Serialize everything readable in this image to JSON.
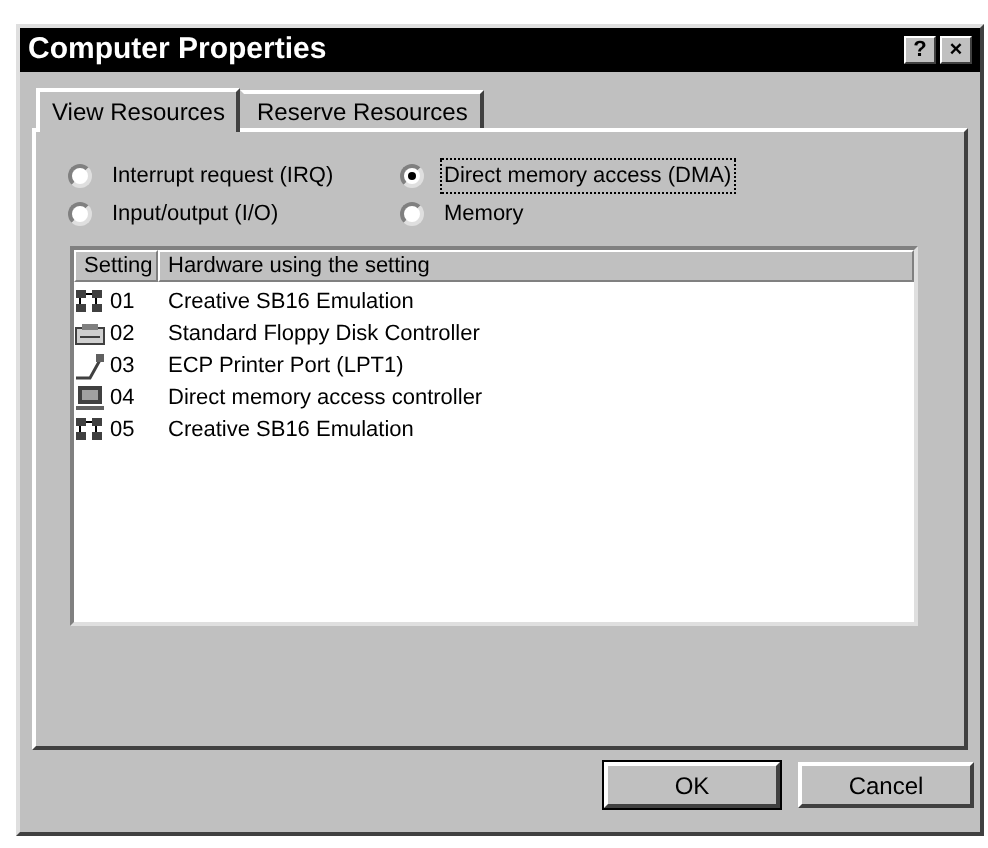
{
  "window": {
    "title": "Computer Properties",
    "buttons": [
      "?",
      "×"
    ]
  },
  "tabs": [
    {
      "label": "View Resources",
      "selected": true
    },
    {
      "label": "Reserve Resources",
      "selected": false
    }
  ],
  "options": [
    {
      "label": "Interrupt request (IRQ)",
      "selected": false
    },
    {
      "label": "Direct memory access (DMA)",
      "selected": true
    },
    {
      "label": "Input/output (I/O)",
      "selected": false
    },
    {
      "label": "Memory",
      "selected": false
    }
  ],
  "table": {
    "columns": [
      "Setting",
      "Hardware using the setting"
    ],
    "rows": [
      {
        "kind": "multimedia",
        "setting": "01",
        "hardware": "Creative SB16 Emulation"
      },
      {
        "kind": "floppy",
        "setting": "02",
        "hardware": "Standard Floppy Disk Controller"
      },
      {
        "kind": "port",
        "setting": "03",
        "hardware": "ECP Printer Port (LPT1)"
      },
      {
        "kind": "system",
        "setting": "04",
        "hardware": "Direct memory access controller"
      },
      {
        "kind": "multimedia",
        "setting": "05",
        "hardware": "Creative SB16 Emulation"
      }
    ]
  },
  "buttons": [
    "OK",
    "Cancel"
  ]
}
